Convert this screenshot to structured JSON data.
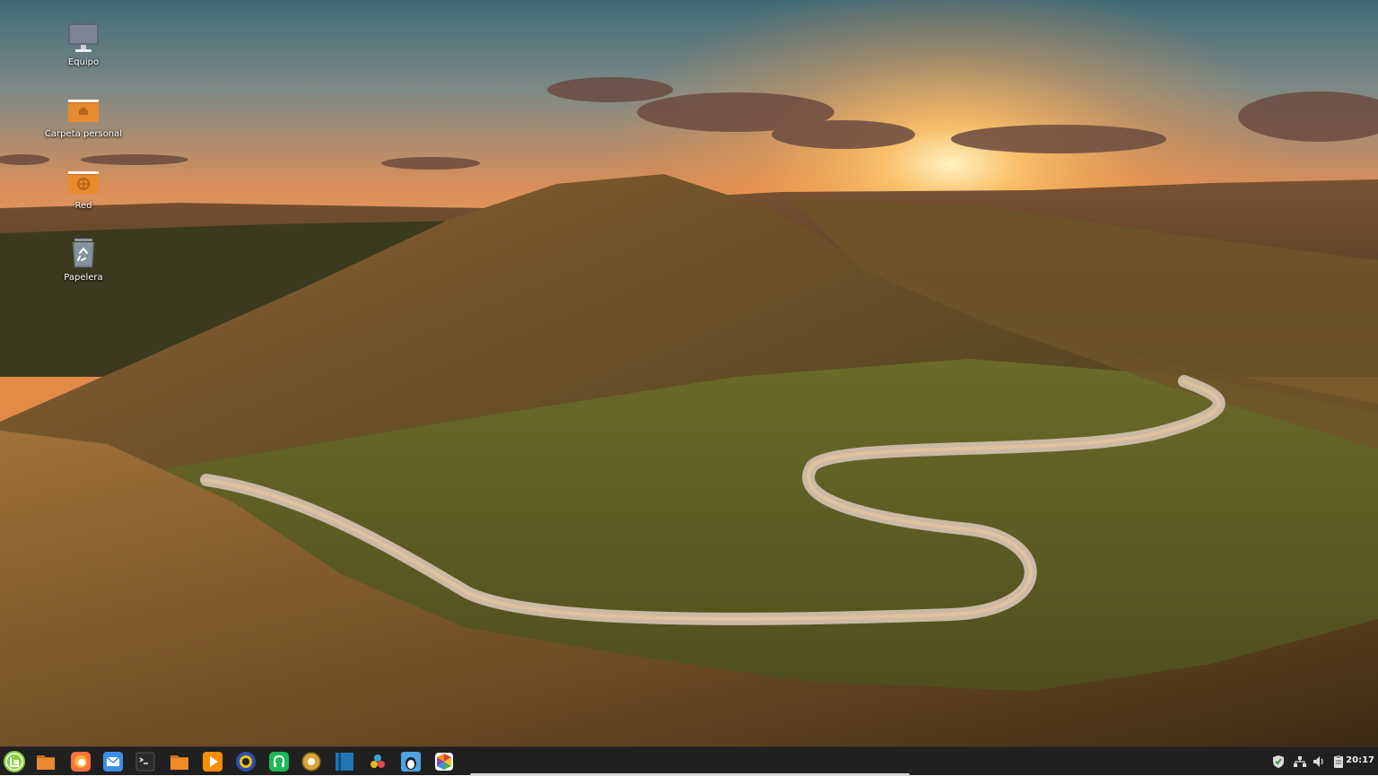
{
  "desktop": {
    "icons": [
      {
        "label": "Equipo",
        "icon": "computer-icon"
      },
      {
        "label": "Carpeta personal",
        "icon": "home-folder-icon"
      },
      {
        "label": "Red",
        "icon": "network-folder-icon"
      },
      {
        "label": "Papelera",
        "icon": "trash-icon"
      }
    ],
    "wallpaper": "sunset-hills-winding-road",
    "accent_folder_color": "#e8862a"
  },
  "taskbar": {
    "apps": [
      {
        "name": "mint-menu-icon",
        "color": "#87cf3e"
      },
      {
        "name": "show-desktop-icon",
        "color": "#e8862a"
      },
      {
        "name": "firefox-icon",
        "color": "#ff7139"
      },
      {
        "name": "mail-icon",
        "color": "#3d8ee4"
      },
      {
        "name": "terminal-icon",
        "color": "#2b2b2b"
      },
      {
        "name": "file-manager-icon",
        "color": "#f08a24"
      },
      {
        "name": "media-player-icon",
        "color": "#ff8c00"
      },
      {
        "name": "transmission-icon",
        "color": "#2e4fb0"
      },
      {
        "name": "spotify-icon",
        "color": "#1db954"
      },
      {
        "name": "software-manager-icon",
        "color": "#d9a43a"
      },
      {
        "name": "book-reader-icon",
        "color": "#1f78b4"
      },
      {
        "name": "davinci-resolve-icon",
        "color": "#3aa5d9"
      },
      {
        "name": "tux-paint-icon",
        "color": "#4ea3e0"
      },
      {
        "name": "color-picker-icon",
        "color": "#e23b3b"
      }
    ],
    "tray": {
      "icons": [
        "shield-icon",
        "network-icon",
        "volume-icon",
        "clipboard-icon"
      ],
      "clock": "20:17"
    }
  }
}
